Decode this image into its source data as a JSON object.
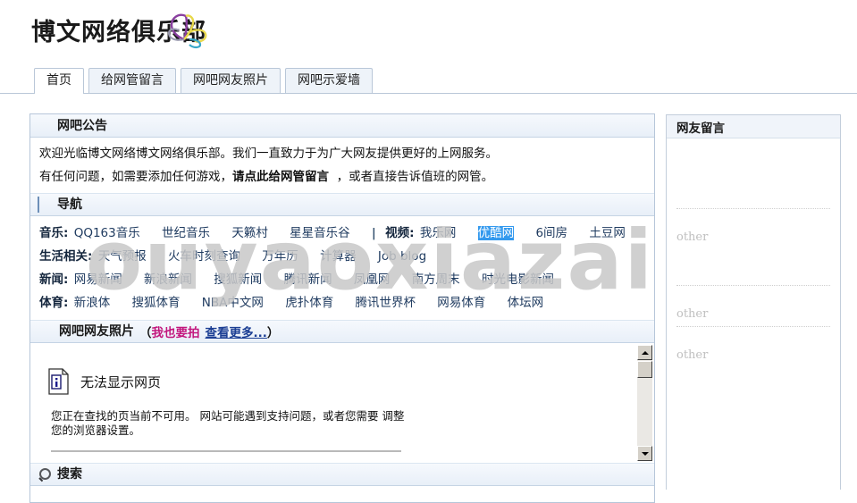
{
  "watermark": "ouyaoxiazai",
  "header": {
    "site_title": "博文网络俱乐部",
    "logo_icon": "butterfly-icon"
  },
  "tabs": [
    {
      "label": "首页",
      "active": true
    },
    {
      "label": "给网管留言",
      "active": false
    },
    {
      "label": "网吧网友照片",
      "active": false
    },
    {
      "label": "网吧示爱墙",
      "active": false
    }
  ],
  "sections": {
    "announcement": {
      "icon": "person-icon",
      "title": "网吧公告",
      "line1": "欢迎光临博文网络博文网络俱乐部。我们一直致力于为广大网友提供更好的上网服务。",
      "line2_pre": "有任何问题，如需要添加任何游戏，",
      "line2_strong": "请点此给网管留言",
      "line2_post": "，或者直接告诉值班的网管。"
    },
    "nav": {
      "icon": "board-icon",
      "title": "导航",
      "rows": [
        {
          "label": "音乐:",
          "links": [
            "QQ163音乐",
            "世纪音乐",
            "天籁村",
            "星星音乐谷"
          ],
          "separator": "|",
          "label2": "视频:",
          "links2": [
            "我乐网",
            "优酷网",
            "6间房",
            "土豆网"
          ],
          "selected_link": "优酷网"
        },
        {
          "label": "生活相关:",
          "links": [
            "天气预报",
            "火车时刻查询",
            "万年历",
            "计算器",
            "Job blog"
          ]
        },
        {
          "label": "新闻:",
          "links": [
            "网易新闻",
            "新浪新闻",
            "搜狐新闻",
            "腾讯新闻",
            "凤凰网",
            "南方周末",
            "时光电影新闻"
          ]
        },
        {
          "label": "体育:",
          "links": [
            "新浪体",
            "搜狐体育",
            "NBA中文网",
            "虎扑体育",
            "腾讯世界杯",
            "网易体育",
            "体坛网"
          ]
        }
      ]
    },
    "photos": {
      "icon": "people-icon",
      "title": "网吧网友照片",
      "paren_open": "（",
      "link_shoot": "我也要拍",
      "link_more": "查看更多...",
      "paren_close": "）",
      "error": {
        "icon": "info-document-icon",
        "title": "无法显示网页",
        "body_line1": "您正在查找的页当前不可用。  网站可能遇到支持问题，或者您需要 调整",
        "body_line2": "您的浏览器设置。"
      },
      "scrollbar": {
        "up_icon": "scroll-up-arrow-icon",
        "down_icon": "scroll-down-arrow-icon"
      }
    },
    "search": {
      "icon": "search-icon",
      "title": "搜索"
    }
  },
  "sidebar": {
    "title": "网友留言",
    "messages": [
      {
        "name": "other"
      },
      {
        "name": "other"
      },
      {
        "name": "other"
      }
    ]
  },
  "colors": {
    "accent_blue": "#1e3a5f",
    "selection_blue": "#3399ee",
    "pink_link": "#c2167d",
    "more_link": "#1c3f94",
    "panel_border": "#b6c6d9",
    "head_gradient_top": "#f6f9fd",
    "head_gradient_bottom": "#e8eff8",
    "watermark_gray": "#c8c8c8"
  }
}
